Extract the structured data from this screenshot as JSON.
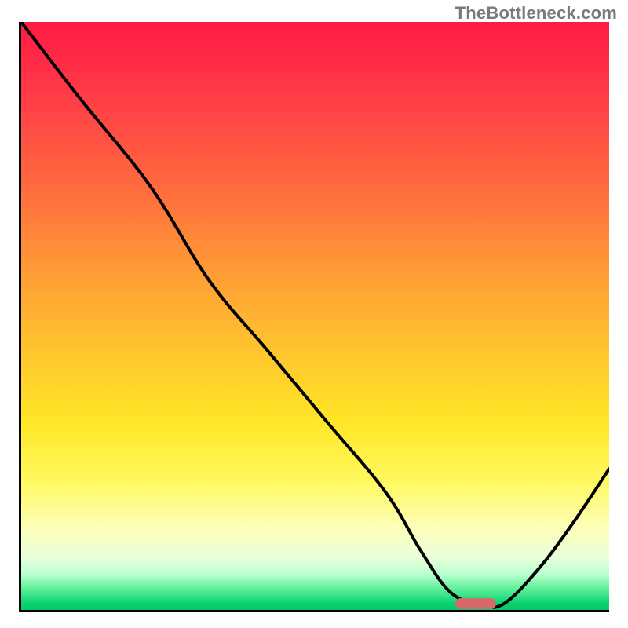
{
  "watermark": "TheBottleneck.com",
  "colors": {
    "gradient_top": "#ff1a44",
    "gradient_mid": "#ffe627",
    "gradient_bottom": "#05c96a",
    "curve": "#000000",
    "marker": "#d46a6a",
    "axis": "#000000"
  },
  "chart_data": {
    "type": "line",
    "title": "",
    "xlabel": "",
    "ylabel": "",
    "xlim": [
      0,
      100
    ],
    "ylim": [
      0,
      100
    ],
    "grid": false,
    "legend": null,
    "series": [
      {
        "name": "bottleneck-curve",
        "x": [
          0,
          10,
          22,
          32,
          42,
          52,
          62,
          68,
          73,
          78,
          82,
          88,
          94,
          100
        ],
        "y": [
          100,
          87,
          72,
          56,
          44,
          32,
          20,
          10,
          3,
          1,
          1,
          7,
          15,
          24
        ]
      }
    ],
    "annotations": [
      {
        "name": "optimal-marker",
        "shape": "pill",
        "x": 77,
        "y": 1.5
      }
    ],
    "note": "x/y are normalized 0-100 for the visible plot area; y=0 is bottom axis, y=100 is top. Values are estimated from pixel positions."
  }
}
